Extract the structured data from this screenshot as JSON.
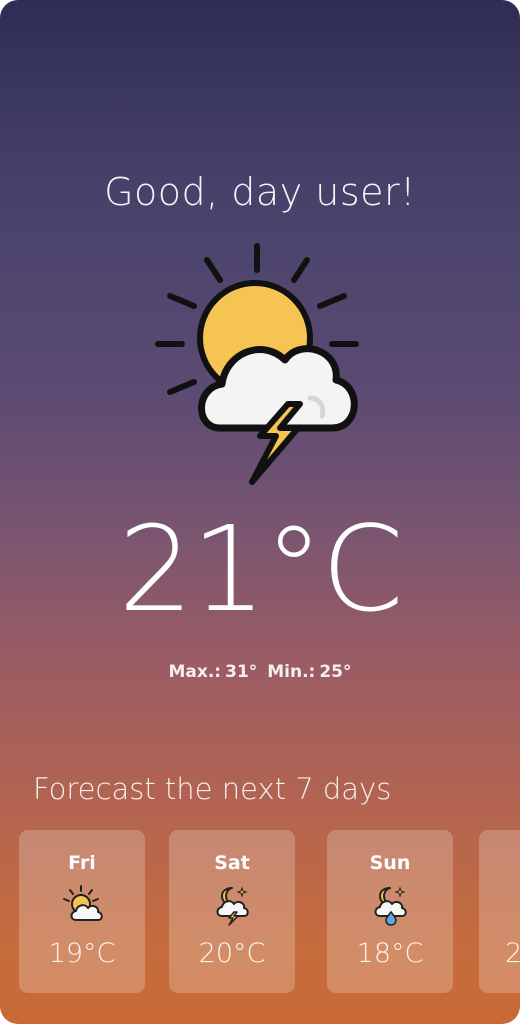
{
  "greeting": "Good, day user!",
  "current": {
    "temperature": "21°C",
    "max_label": "Max.:",
    "max_value": "31°",
    "min_label": "Min.:",
    "min_value": "25°",
    "icon": "sun-cloud-lightning-icon"
  },
  "forecast": {
    "title": "Forecast the next 7 days",
    "days": [
      {
        "day": "Fri",
        "temp": "19°C",
        "icon": "partly-sunny-icon"
      },
      {
        "day": "Sat",
        "temp": "20°C",
        "icon": "night-thunderstorm-icon"
      },
      {
        "day": "Sun",
        "temp": "18°C",
        "icon": "night-rain-icon"
      },
      {
        "day": "",
        "temp": "2",
        "icon": ""
      }
    ]
  },
  "colors": {
    "gradient_top": "#2f2d55",
    "gradient_bottom": "#c96a35",
    "sun": "#f6c453",
    "cloud": "#f4f4f4",
    "outline": "#111111"
  }
}
